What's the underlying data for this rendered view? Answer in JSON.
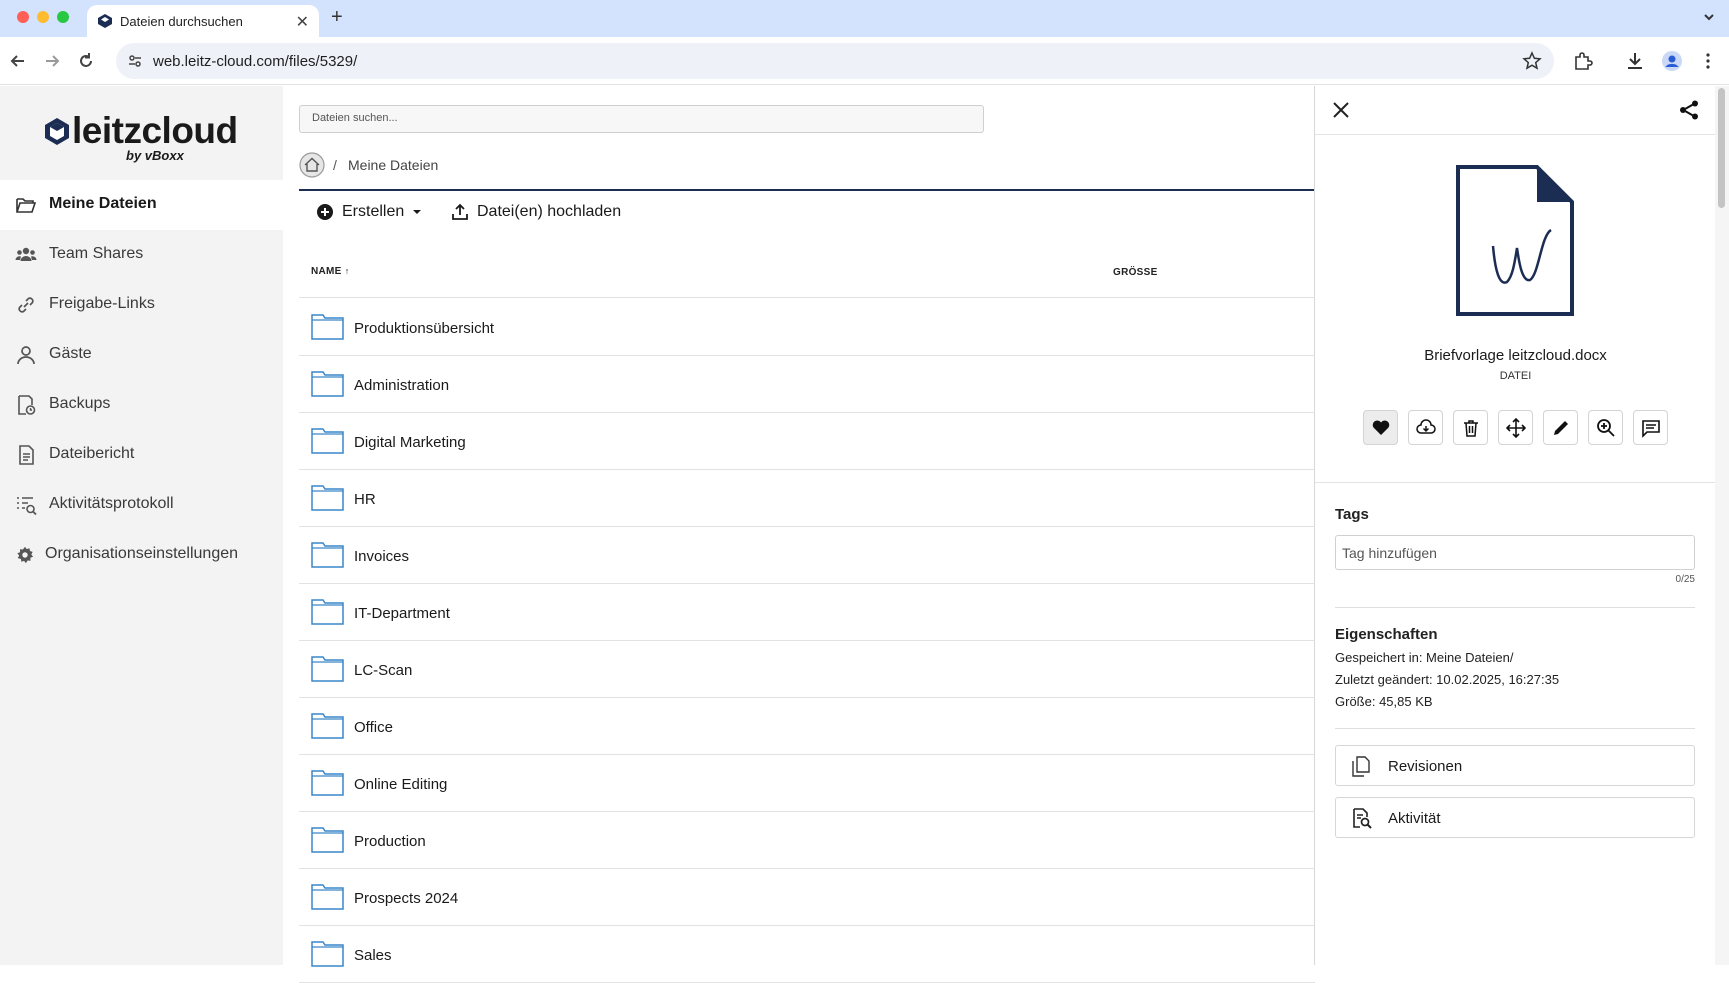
{
  "browser": {
    "tab_title": "Dateien durchsuchen",
    "url": "web.leitz-cloud.com/files/5329/"
  },
  "logo": {
    "text": "leitzcloud",
    "sub": "by vBoxx"
  },
  "sidebar": {
    "items": [
      {
        "label": "Meine Dateien",
        "icon": "folder-open-icon",
        "active": true
      },
      {
        "label": "Team Shares",
        "icon": "users-icon",
        "active": false
      },
      {
        "label": "Freigabe-Links",
        "icon": "link-icon",
        "active": false
      },
      {
        "label": "Gäste",
        "icon": "user-icon",
        "active": false
      },
      {
        "label": "Backups",
        "icon": "backup-icon",
        "active": false
      },
      {
        "label": "Dateibericht",
        "icon": "report-icon",
        "active": false
      },
      {
        "label": "Aktivitätsprotokoll",
        "icon": "activity-log-icon",
        "active": false
      },
      {
        "label": "Organisationseinstellungen",
        "icon": "gear-icon",
        "active": false
      }
    ]
  },
  "main": {
    "search_placeholder": "Dateien suchen...",
    "breadcrumb": {
      "separator": "/",
      "label": "Meine Dateien"
    },
    "actions": {
      "create": "Erstellen",
      "upload": "Datei(en) hochladen"
    },
    "columns": {
      "name": "NAME",
      "size": "GRÖSSE"
    },
    "folders": [
      "Produktionsübersicht",
      "Administration",
      "Digital Marketing",
      "HR",
      "Invoices",
      "IT-Department",
      "LC-Scan",
      "Office",
      "Online Editing",
      "Production",
      "Prospects 2024",
      "Sales"
    ]
  },
  "panel": {
    "file_name": "Briefvorlage leitzcloud.docx",
    "file_type": "DATEI",
    "tags_title": "Tags",
    "tag_placeholder": "Tag hinzufügen",
    "tag_count": "0/25",
    "props_title": "Eigenschaften",
    "props": {
      "saved_in": "Gespeichert in: Meine Dateien/",
      "modified": "Zuletzt geändert: 10.02.2025, 16:27:35",
      "size": "Größe: 45,85 KB"
    },
    "revisions_label": "Revisionen",
    "activity_label": "Aktivität"
  },
  "colors": {
    "brand_navy": "#1b2d52",
    "folder_blue": "#3a86c8",
    "tabbar": "#d3e3fd"
  }
}
